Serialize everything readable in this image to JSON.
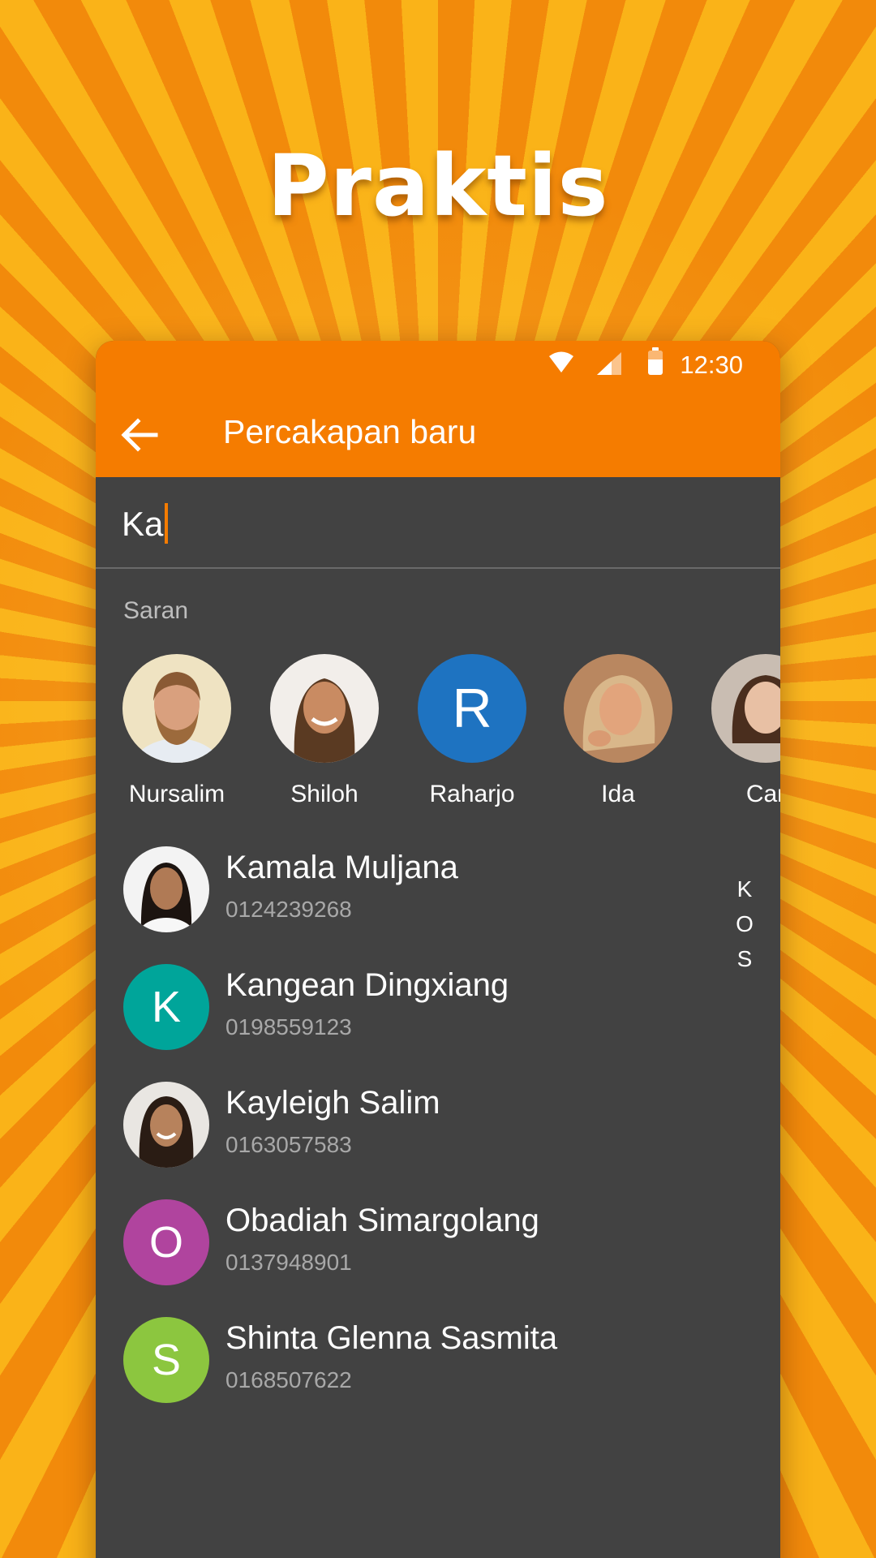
{
  "headline": "Praktis",
  "status_bar": {
    "time": "12:30",
    "icons": [
      "wifi-icon",
      "signal-icon",
      "battery-icon"
    ]
  },
  "app_bar": {
    "back_icon": "arrow-left-icon",
    "title": "Percakapan baru"
  },
  "search": {
    "value": "Ka"
  },
  "suggestions": {
    "label": "Saran",
    "items": [
      {
        "name": "Nursalim",
        "avatar": "photo"
      },
      {
        "name": "Shiloh",
        "avatar": "photo"
      },
      {
        "name": "Raharjo",
        "avatar": "letter",
        "initial": "R",
        "color": "#1E73C1"
      },
      {
        "name": "Ida",
        "avatar": "photo"
      },
      {
        "name": "Car",
        "avatar": "photo"
      }
    ]
  },
  "contacts": [
    {
      "name": "Kamala Muljana",
      "number": "0124239268",
      "avatar": "photo"
    },
    {
      "name": "Kangean Dingxiang",
      "number": "0198559123",
      "avatar": "letter",
      "initial": "K",
      "color": "#00A59A"
    },
    {
      "name": "Kayleigh Salim",
      "number": "0163057583",
      "avatar": "photo"
    },
    {
      "name": "Obadiah Simargolang",
      "number": "0137948901",
      "avatar": "letter",
      "initial": "O",
      "color": "#B0449E"
    },
    {
      "name": "Shinta Glenna Sasmita",
      "number": "0168507622",
      "avatar": "letter",
      "initial": "S",
      "color": "#8CC63F"
    }
  ],
  "index_letters": [
    "K",
    "O",
    "S"
  ],
  "colors": {
    "accent": "#F57C00",
    "surface": "#424242",
    "secondary_text": "#A8A8A8"
  }
}
